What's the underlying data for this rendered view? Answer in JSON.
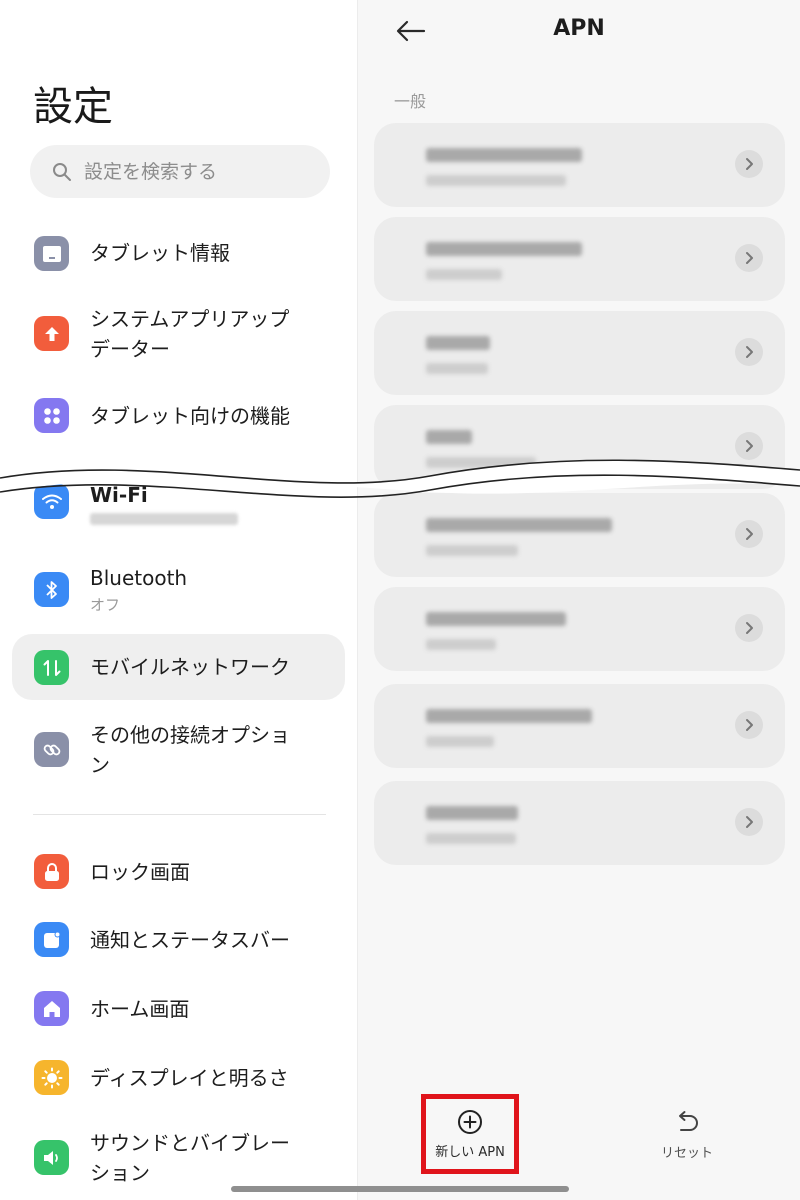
{
  "left": {
    "title": "設定",
    "search_placeholder": "設定を検索する",
    "items": [
      {
        "label": "タブレット情報",
        "icon": "tablet-icon",
        "color": "#8a90a8"
      },
      {
        "label": "システムアプリアップ",
        "label2": "データー",
        "icon": "arrow-up-icon",
        "color": "#f25d3c"
      },
      {
        "label": "タブレット向けの機能",
        "icon": "grid-icon",
        "color": "#8478f0"
      },
      {
        "label": "Wi-Fi",
        "icon": "wifi-icon",
        "color": "#3a8af5"
      },
      {
        "label": "Bluetooth",
        "sub": "オフ",
        "icon": "bluetooth-icon",
        "color": "#3a8af5"
      },
      {
        "label": "モバイルネットワーク",
        "icon": "mobile-data-icon",
        "color": "#36c36a"
      },
      {
        "label": "その他の接続オプショ",
        "label2": "ン",
        "icon": "link-icon",
        "color": "#8a90a8"
      },
      {
        "label": "ロック画面",
        "icon": "lock-icon",
        "color": "#f25d3c"
      },
      {
        "label": "通知とステータスバー",
        "icon": "notification-icon",
        "color": "#3a8af5"
      },
      {
        "label": "ホーム画面",
        "icon": "home-icon",
        "color": "#8478f0"
      },
      {
        "label": "ディスプレイと明るさ",
        "icon": "sun-icon",
        "color": "#f6b52d"
      },
      {
        "label": "サウンドとバイブレー",
        "label2": "ション",
        "icon": "speaker-icon",
        "color": "#36c36a"
      }
    ]
  },
  "right": {
    "title": "APN",
    "section": "一般",
    "new_apn_label": "新しい APN",
    "reset_label": "リセット"
  }
}
